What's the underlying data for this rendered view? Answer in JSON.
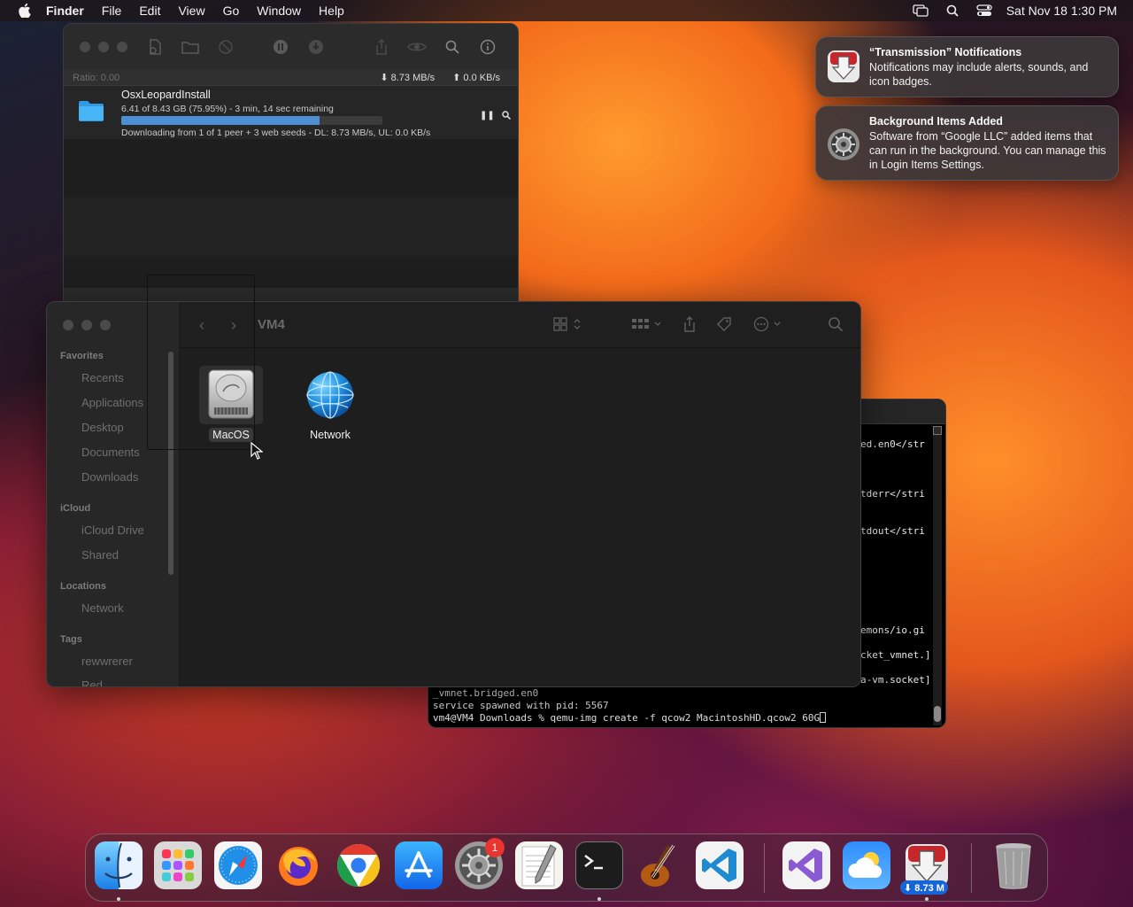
{
  "menubar": {
    "app": "Finder",
    "items": [
      "File",
      "Edit",
      "View",
      "Go",
      "Window",
      "Help"
    ],
    "clock": "Sat Nov 18  1:30 PM"
  },
  "transmission": {
    "ratio": "Ratio: 0.00",
    "download_rate": "8.73 MB/s",
    "upload_rate": "0.0 KB/s",
    "torrent": {
      "name": "OsxLeopardInstall",
      "progress_text": "6.41 of 8.43 GB (75.95%) - 3 min, 14 sec remaining",
      "progress_fraction": 0.7595,
      "status": "Downloading from 1 of 1 peer + 3 web seeds - DL: 8.73 MB/s, UL: 0.0 KB/s"
    }
  },
  "finder": {
    "title": "VM4",
    "sidebar": {
      "favorites_header": "Favorites",
      "favorites": [
        "Recents",
        "Applications",
        "Desktop",
        "Documents",
        "Downloads"
      ],
      "icloud_header": "iCloud",
      "icloud": [
        "iCloud Drive",
        "Shared"
      ],
      "locations_header": "Locations",
      "locations": [
        "Network"
      ],
      "tags_header": "Tags",
      "tags": [
        "rewwrerer",
        "Red"
      ]
    },
    "items": [
      {
        "label": "MacOS",
        "icon": "hard-drive-icon",
        "selected": true
      },
      {
        "label": "Network",
        "icon": "network-globe-icon",
        "selected": false
      }
    ]
  },
  "terminal": {
    "right_fragments": [
      "ed.en0</str",
      "tderr</stri",
      "tdout</stri",
      "emons/io.gi",
      "cket_vmnet.]",
      "a-vm.socket]"
    ],
    "lines": [
      "_vmnet.bridged.en0",
      "service spawned with pid: 5567",
      "vm4@VM4 Downloads % qemu-img create -f qcow2 MacintoshHD.qcow2 60G"
    ]
  },
  "notifications": [
    {
      "title": "“Transmission” Notifications",
      "body": "Notifications may include alerts, sounds, and icon badges."
    },
    {
      "title": "Background Items Added",
      "body": "Software from “Google LLC” added items that can run in the background. You can manage this in Login Items Settings."
    }
  ],
  "dock": {
    "settings_badge": "1",
    "transmission_badge": "⬇ 8.73 M",
    "apps": [
      "finder",
      "launchpad",
      "safari",
      "firefox",
      "chrome",
      "app-store",
      "system-settings",
      "textedit",
      "terminal",
      "garageband",
      "vscode",
      "visual-studio",
      "weather",
      "transmission",
      "trash"
    ]
  }
}
